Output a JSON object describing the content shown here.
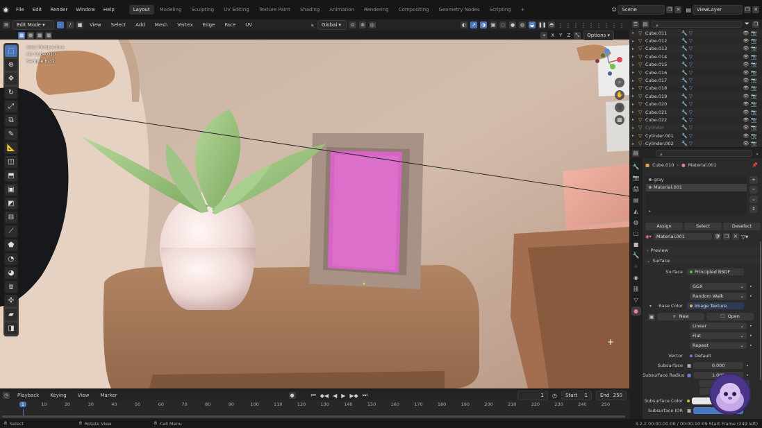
{
  "topbar": {
    "menus": [
      "File",
      "Edit",
      "Render",
      "Window",
      "Help"
    ],
    "workspaces": [
      "Layout",
      "Modeling",
      "Sculpting",
      "UV Editing",
      "Texture Paint",
      "Shading",
      "Animation",
      "Rendering",
      "Compositing",
      "Geometry Nodes",
      "Scripting"
    ],
    "active_workspace": "Layout",
    "add_tab": "+",
    "scene": "Scene",
    "view_layer": "ViewLayer"
  },
  "viewport_header": {
    "mode": "Edit Mode",
    "menus": [
      "View",
      "Select",
      "Add",
      "Mesh",
      "Vertex",
      "Edge",
      "Face",
      "UV"
    ],
    "orientation": "Global",
    "options_label": "Options",
    "axes": [
      "X",
      "Y",
      "Z"
    ]
  },
  "viewport_info": {
    "line1": "User Perspective",
    "line2": "(1) Cube.010",
    "line3": "Sample 6/32"
  },
  "gizmo": {
    "x": "X",
    "y": "Y",
    "z": "Z"
  },
  "outliner": {
    "rows": [
      {
        "name": "Cube.011"
      },
      {
        "name": "Cube.012"
      },
      {
        "name": "Cube.013"
      },
      {
        "name": "Cube.014"
      },
      {
        "name": "Cube.015"
      },
      {
        "name": "Cube.016"
      },
      {
        "name": "Cube.017"
      },
      {
        "name": "Cube.018"
      },
      {
        "name": "Cube.019"
      },
      {
        "name": "Cube.020"
      },
      {
        "name": "Cube.021"
      },
      {
        "name": "Cube.022"
      },
      {
        "name": "Cylinder"
      },
      {
        "name": "Cylinder.001"
      },
      {
        "name": "Cylinder.002"
      },
      {
        "name": "Cylinder.003"
      }
    ]
  },
  "properties": {
    "breadcrumb_object": "Cube.010",
    "breadcrumb_material": "Material.001",
    "material_slots": [
      "gray",
      "Material.001"
    ],
    "active_slot": "Material.001",
    "assign": "Assign",
    "select": "Select",
    "deselect": "Deselect",
    "material_name": "Material.001",
    "preview": "Preview",
    "surface_panel": "Surface",
    "surface_label": "Surface",
    "surface_value": "Principled BSDF",
    "distribution": "GGX",
    "subsurface_method": "Random Walk",
    "base_color_label": "Base Color",
    "base_color_value": "Image Texture",
    "new_label": "New",
    "open_label": "Open",
    "interpolation": "Linear",
    "projection": "Flat",
    "extension": "Repeat",
    "vector_label": "Vector",
    "vector_value": "Default",
    "subsurface_label": "Subsurface",
    "subsurface_value": "0.000",
    "subsurface_radius_label": "Subsurface Radius",
    "subsurface_radius_value": "1.000",
    "subsurface_color_label": "Subsurface Color",
    "subsurface_ior_label": "Subsurface IOR"
  },
  "timeline": {
    "menus": [
      "Playback",
      "Keying",
      "View",
      "Marker"
    ],
    "current_frame": "1",
    "start_label": "Start",
    "start": "1",
    "end_label": "End",
    "end": "250",
    "ticks": [
      "1",
      "10",
      "20",
      "30",
      "40",
      "50",
      "60",
      "70",
      "80",
      "90",
      "100",
      "110",
      "120",
      "130",
      "140",
      "150",
      "160",
      "170",
      "180",
      "190",
      "200",
      "210",
      "220",
      "230",
      "240",
      "250"
    ]
  },
  "statusbar": {
    "select": "Select",
    "rotate": "Rotate View",
    "call_menu": "Call Menu",
    "info": "3.2.2  00:00:00:00 / 00:00:10:09  Start Frame (249 left)"
  },
  "colors": {
    "accent": "#4c74b8",
    "object_orange": "#e9a04e",
    "pink_screen": "#d664c4"
  }
}
